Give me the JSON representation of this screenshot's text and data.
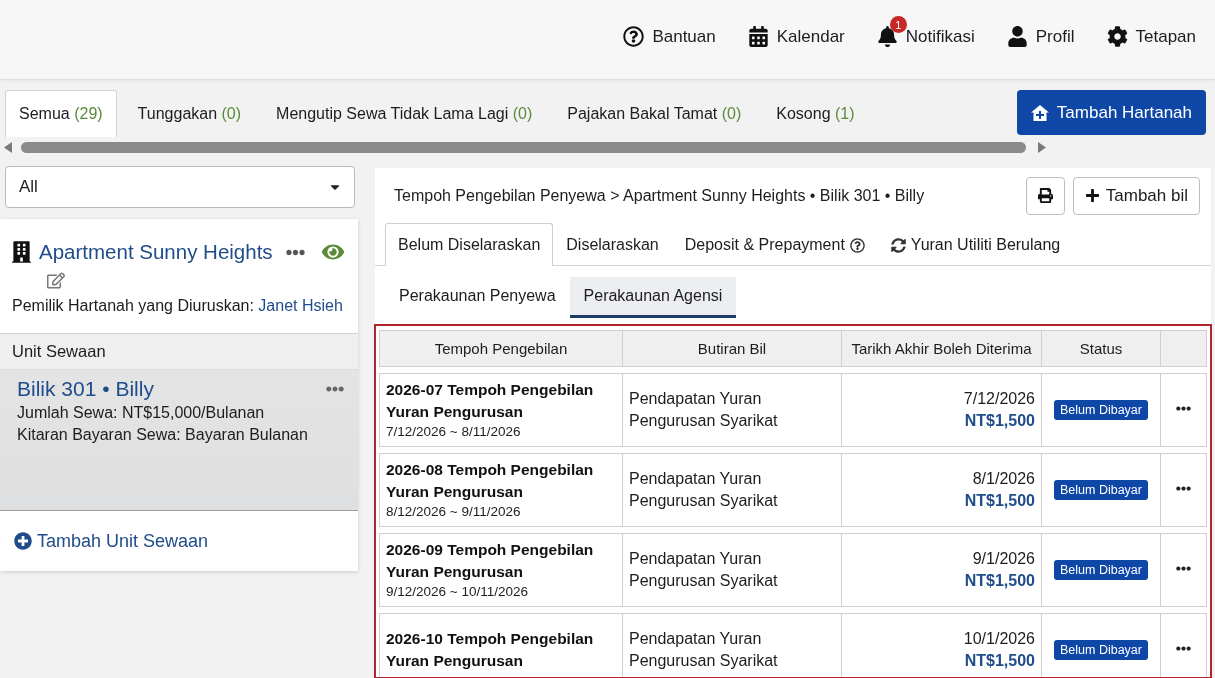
{
  "top_nav": [
    {
      "kind": "help",
      "label": "Bantuan"
    },
    {
      "kind": "calendar",
      "label": "Kalendar"
    },
    {
      "kind": "notifications",
      "label": "Notifikasi",
      "badge": "1"
    },
    {
      "kind": "profile",
      "label": "Profil"
    },
    {
      "kind": "settings",
      "label": "Tetapan"
    }
  ],
  "property_tabs": [
    {
      "label": "Semua",
      "count": "(29)",
      "selected": true
    },
    {
      "label": "Tunggakan",
      "count": "(0)",
      "selected": false
    },
    {
      "label": "Mengutip Sewa Tidak Lama Lagi",
      "count": "(0)",
      "selected": false
    },
    {
      "label": "Pajakan Bakal Tamat",
      "count": "(0)",
      "selected": false
    },
    {
      "label": "Kosong",
      "count": "(1)",
      "selected": false
    }
  ],
  "add_property_button": "Tambah Hartanah",
  "filter": {
    "value": "All"
  },
  "property": {
    "name": "Apartment Sunny Heights",
    "owner_label": "Pemilik Hartanah yang Diuruskan:",
    "owner": "Janet Hsieh"
  },
  "units": {
    "heading": "Unit Sewaan",
    "items": [
      {
        "name": "Bilik 301 • Billy",
        "rent": "Jumlah Sewa: NT$15,000/Bulanan",
        "cycle": "Kitaran Bayaran Sewa: Bayaran Bulanan",
        "selected": true
      }
    ],
    "add_label": "Tambah Unit Sewaan"
  },
  "breadcrumb": "Tempoh Pengebilan Penyewa > Apartment Sunny Heights • Bilik 301 • Billy",
  "add_bill_button": "Tambah bil",
  "bill_tabs": [
    {
      "kind": "plain",
      "label": "Belum Diselaraskan",
      "selected": true
    },
    {
      "kind": "plain",
      "label": "Diselaraskan",
      "selected": false
    },
    {
      "kind": "help",
      "label": "Deposit & Prepayment",
      "selected": false
    },
    {
      "kind": "recurring",
      "label": "Yuran Utiliti Berulang",
      "selected": false
    }
  ],
  "account_tabs": [
    {
      "label": "Perakaunan Penyewa",
      "selected": false
    },
    {
      "label": "Perakaunan Agensi",
      "selected": true
    }
  ],
  "table": {
    "columns": [
      "Tempoh Pengebilan",
      "Butiran Bil",
      "Tarikh Akhir Boleh Diterima",
      "Status"
    ],
    "rows": [
      {
        "title": "2026-07 Tempoh Pengebilan Yuran Pengurusan",
        "period": "7/12/2026 ~ 8/11/2026",
        "details": "Pendapatan Yuran Pengurusan Syarikat",
        "due_date": "7/12/2026",
        "amount": "NT$1,500",
        "status": "Belum Dibayar"
      },
      {
        "title": "2026-08 Tempoh Pengebilan Yuran Pengurusan",
        "period": "8/12/2026 ~ 9/11/2026",
        "details": "Pendapatan Yuran Pengurusan Syarikat",
        "due_date": "8/1/2026",
        "amount": "NT$1,500",
        "status": "Belum Dibayar"
      },
      {
        "title": "2026-09 Tempoh Pengebilan Yuran Pengurusan",
        "period": "9/12/2026 ~ 10/11/2026",
        "details": "Pendapatan Yuran Pengurusan Syarikat",
        "due_date": "9/1/2026",
        "amount": "NT$1,500",
        "status": "Belum Dibayar"
      },
      {
        "title": "2026-10 Tempoh Pengebilan Yuran Pengurusan",
        "details": "Pendapatan Yuran Pengurusan Syarikat",
        "due_date": "10/1/2026",
        "amount": "NT$1,500",
        "status": "Belum Dibayar"
      }
    ]
  }
}
